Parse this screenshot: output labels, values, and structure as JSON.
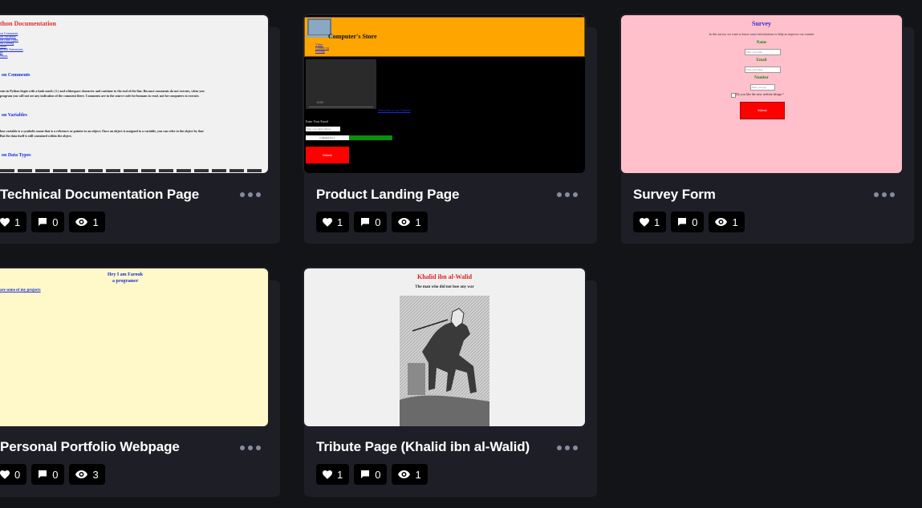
{
  "projects": [
    {
      "title": "Technical Documentation Page",
      "likes": "1",
      "comments": "0",
      "views": "1"
    },
    {
      "title": "Product Landing Page",
      "likes": "1",
      "comments": "0",
      "views": "1"
    },
    {
      "title": "Survey Form",
      "likes": "1",
      "comments": "0",
      "views": "1"
    },
    {
      "title": "Personal Portfolio Webpage",
      "likes": "0",
      "comments": "0",
      "views": "3"
    },
    {
      "title": "Tribute Page (Khalid ibn al-Walid)",
      "likes": "1",
      "comments": "0",
      "views": "1"
    }
  ],
  "previews": {
    "doc": {
      "heading": "thon Documentation",
      "links": [
        "on Comments",
        "on Variables",
        "on Data Types",
        "on Casting",
        "ables",
        "itional Statements",
        "ps",
        "ctions"
      ],
      "s1": "on Comments",
      "p1a": "ents in Python begin with a hash mark ( # ) and whitespace character and continue to the end of the line. Because comments do not execute, when you",
      "p1b": "program you will not see any indication of the comment there. Comments are in the source code for humans to read, not for computers to execute.",
      "s2": "on Variables",
      "p2a": "hon variable is a symbolic name that is a reference or pointer to an object. Once an object is assigned to a variable, you can refer to the object by that",
      "p2b": "But the data itself is still contained within the object.",
      "s3": "on Data Types"
    },
    "product": {
      "store": "Computer's Store",
      "nav": [
        "Video",
        "Contact us",
        "Pricing"
      ],
      "time": "0:00",
      "link": "Subscribe to our Channel",
      "email_label": "Enter Your Email",
      "email_ph": "Enter your email address",
      "select": "Computer Pro 1",
      "submit": "Submit"
    },
    "survey": {
      "title": "Survey",
      "intro": "In this survey we want to know some informations to help us improve our content",
      "name": "Name",
      "name_ph": "Enter your name",
      "email": "Email",
      "email_ph": "Enter your email",
      "number": "Number",
      "number_ph": "Enter your age",
      "question": "Do you like the new website design ?",
      "submit": "Submit"
    },
    "portfolio": {
      "l1": "Hey I am Farouk",
      "l2": "a programer",
      "link": "are some of my projects"
    },
    "tribute": {
      "title": "Khalid ibn al-Walid",
      "subtitle": "The man who did not lose any war"
    }
  }
}
